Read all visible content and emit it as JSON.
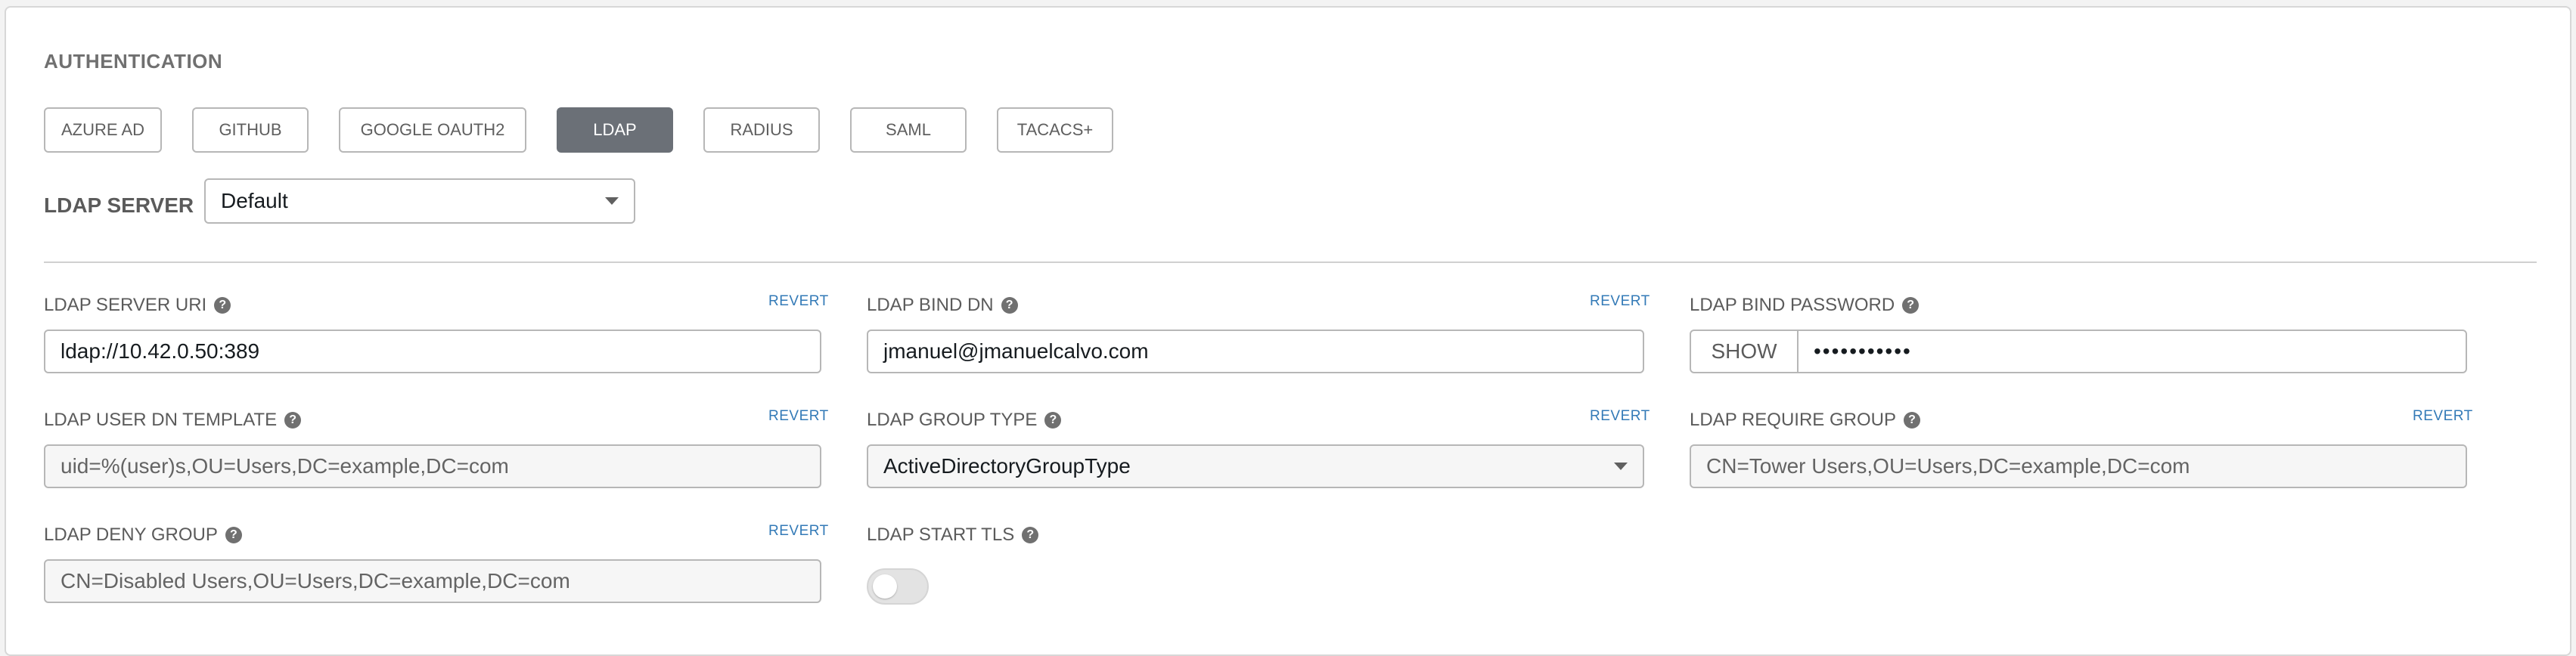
{
  "section_title": "AUTHENTICATION",
  "tabs": [
    {
      "label": "AZURE AD",
      "active": false
    },
    {
      "label": "GITHUB",
      "active": false
    },
    {
      "label": "GOOGLE OAUTH2",
      "active": false
    },
    {
      "label": "LDAP",
      "active": true
    },
    {
      "label": "RADIUS",
      "active": false
    },
    {
      "label": "SAML",
      "active": false
    },
    {
      "label": "TACACS+",
      "active": false
    }
  ],
  "ldap_server": {
    "label": "LDAP SERVER",
    "selected": "Default"
  },
  "fields": {
    "server_uri": {
      "label": "LDAP SERVER URI",
      "value": "ldap://10.42.0.50:389",
      "revert": "REVERT"
    },
    "bind_dn": {
      "label": "LDAP BIND DN",
      "value": "jmanuel@jmanuelcalvo.com",
      "revert": "REVERT"
    },
    "bind_password": {
      "label": "LDAP BIND PASSWORD",
      "show_label": "SHOW",
      "masked_value": "•••••••••••"
    },
    "user_dn_template": {
      "label": "LDAP USER DN TEMPLATE",
      "placeholder": "uid=%(user)s,OU=Users,DC=example,DC=com",
      "revert": "REVERT"
    },
    "group_type": {
      "label": "LDAP GROUP TYPE",
      "selected": "ActiveDirectoryGroupType",
      "revert": "REVERT"
    },
    "require_group": {
      "label": "LDAP REQUIRE GROUP",
      "placeholder": "CN=Tower Users,OU=Users,DC=example,DC=com",
      "revert": "REVERT"
    },
    "deny_group": {
      "label": "LDAP DENY GROUP",
      "placeholder": "CN=Disabled Users,OU=Users,DC=example,DC=com",
      "revert": "REVERT"
    },
    "start_tls": {
      "label": "LDAP START TLS",
      "enabled": false
    }
  },
  "help_glyph": "?",
  "icons": {
    "help": "question-circle-icon",
    "caret": "caret-down-icon"
  },
  "colors": {
    "active_tab": "#6b7077",
    "revert_link": "#337ab7"
  }
}
